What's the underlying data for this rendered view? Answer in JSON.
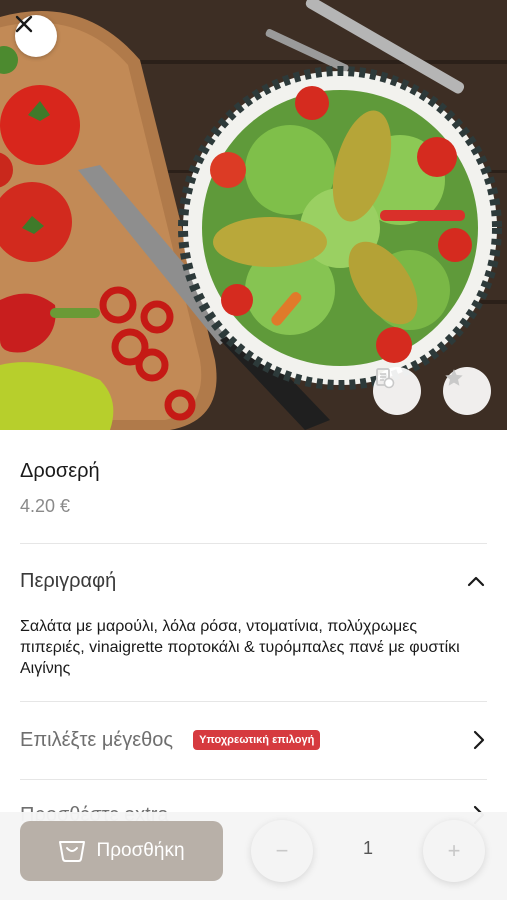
{
  "product": {
    "name": "Δροσερή",
    "price": "4.20 €"
  },
  "description_section": {
    "label": "Περιγραφή",
    "text": "Σαλάτα με μαρούλι, λόλα ρόσα, ντοματίνια, πολύχρωμες πιπεριές, vinaigrette πορτοκάλι & τυρόμπαλες πανέ με φυστίκι Αιγίνης"
  },
  "size_section": {
    "label": "Επιλέξτε μέγεθος",
    "badge": "Υποχρεωτική επιλογή"
  },
  "extras_section": {
    "label": "Προσθέστε extra"
  },
  "bottom_bar": {
    "add_label": "Προσθήκη",
    "minus_label": "−",
    "plus_label": "+",
    "quantity": "1"
  },
  "icons": {
    "close": "close-icon",
    "menu_note": "note-icon",
    "favorite": "star-icon",
    "basket": "basket-icon"
  },
  "colors": {
    "badge": "#d63a3f",
    "add_button": "#b8b0a8"
  }
}
